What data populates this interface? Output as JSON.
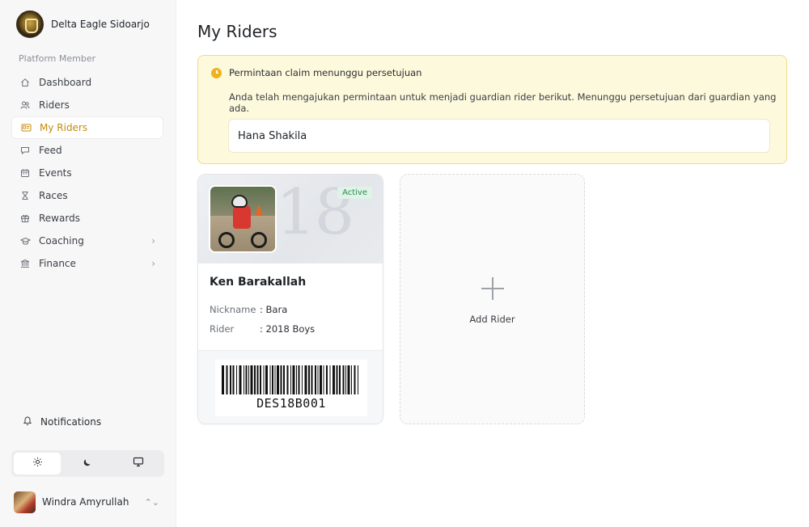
{
  "sidebar": {
    "brand_name": "Delta Eagle Sidoarjo",
    "section_label": "Platform Member",
    "items": [
      {
        "label": "Dashboard",
        "icon": "home-icon"
      },
      {
        "label": "Riders",
        "icon": "users-icon"
      },
      {
        "label": "My Riders",
        "icon": "id-card-icon",
        "active": true
      },
      {
        "label": "Feed",
        "icon": "chat-icon"
      },
      {
        "label": "Events",
        "icon": "calendar-icon"
      },
      {
        "label": "Races",
        "icon": "hourglass-icon"
      },
      {
        "label": "Rewards",
        "icon": "gift-icon"
      },
      {
        "label": "Coaching",
        "icon": "graduation-cap-icon",
        "has_submenu": true
      },
      {
        "label": "Finance",
        "icon": "bank-icon",
        "has_submenu": true
      }
    ],
    "notifications_label": "Notifications",
    "theme_options": [
      {
        "name": "sun-icon",
        "active": true
      },
      {
        "name": "moon-icon",
        "active": false
      },
      {
        "name": "monitor-icon",
        "active": false
      }
    ],
    "user_name": "Windra Amyrullah"
  },
  "main": {
    "title": "My Riders",
    "alert": {
      "heading": "Permintaan claim menunggu persetujuan",
      "description": "Anda telah mengajukan permintaan untuk menjadi guardian rider berikut. Menunggu persetujuan dari guardian yang ada.",
      "pending_rider": "Hana Shakila"
    },
    "rider_card": {
      "number": "18",
      "status": "Active",
      "name": "Ken Barakallah",
      "nickname_label": "Nickname",
      "nickname_value": ": Bara",
      "rider_label": "Rider",
      "rider_value": ": 2018 Boys",
      "barcode_text": "DES18B001"
    },
    "add_card_label": "Add Rider"
  },
  "colors": {
    "accent": "#c58b0e",
    "alert_bg": "#fdf9dc",
    "alert_border": "#f1dc8a",
    "active_badge_bg": "#dff3e6",
    "active_badge_text": "#2f8a54"
  }
}
